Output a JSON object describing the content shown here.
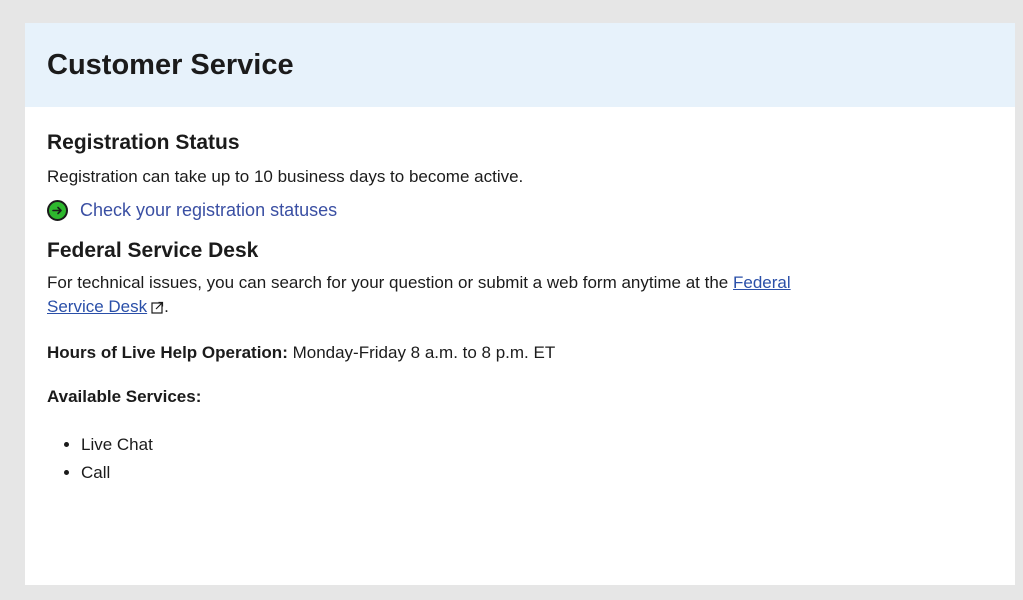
{
  "header": {
    "title": "Customer Service"
  },
  "registration": {
    "heading": "Registration Status",
    "text": "Registration can take up to 10 business days to become active.",
    "link_label": "Check your registration statuses",
    "link_icon": "arrow-right-circle-icon"
  },
  "fsd": {
    "heading": "Federal Service Desk",
    "text_before": "For technical issues, you can search for your question or submit a web form anytime at the ",
    "link_label": "Federal Service Desk",
    "text_after": ".",
    "link_icon": "external-link-icon"
  },
  "hours": {
    "label": "Hours of Live Help Operation:",
    "value": " Monday-Friday 8 a.m. to 8 p.m. ET"
  },
  "services": {
    "label": "Available Services:",
    "items": [
      "Live Chat",
      "Call"
    ]
  },
  "colors": {
    "header_bg": "#e7f2fb",
    "link": "#2a4fa8",
    "arrow_green": "#2eb82e"
  }
}
